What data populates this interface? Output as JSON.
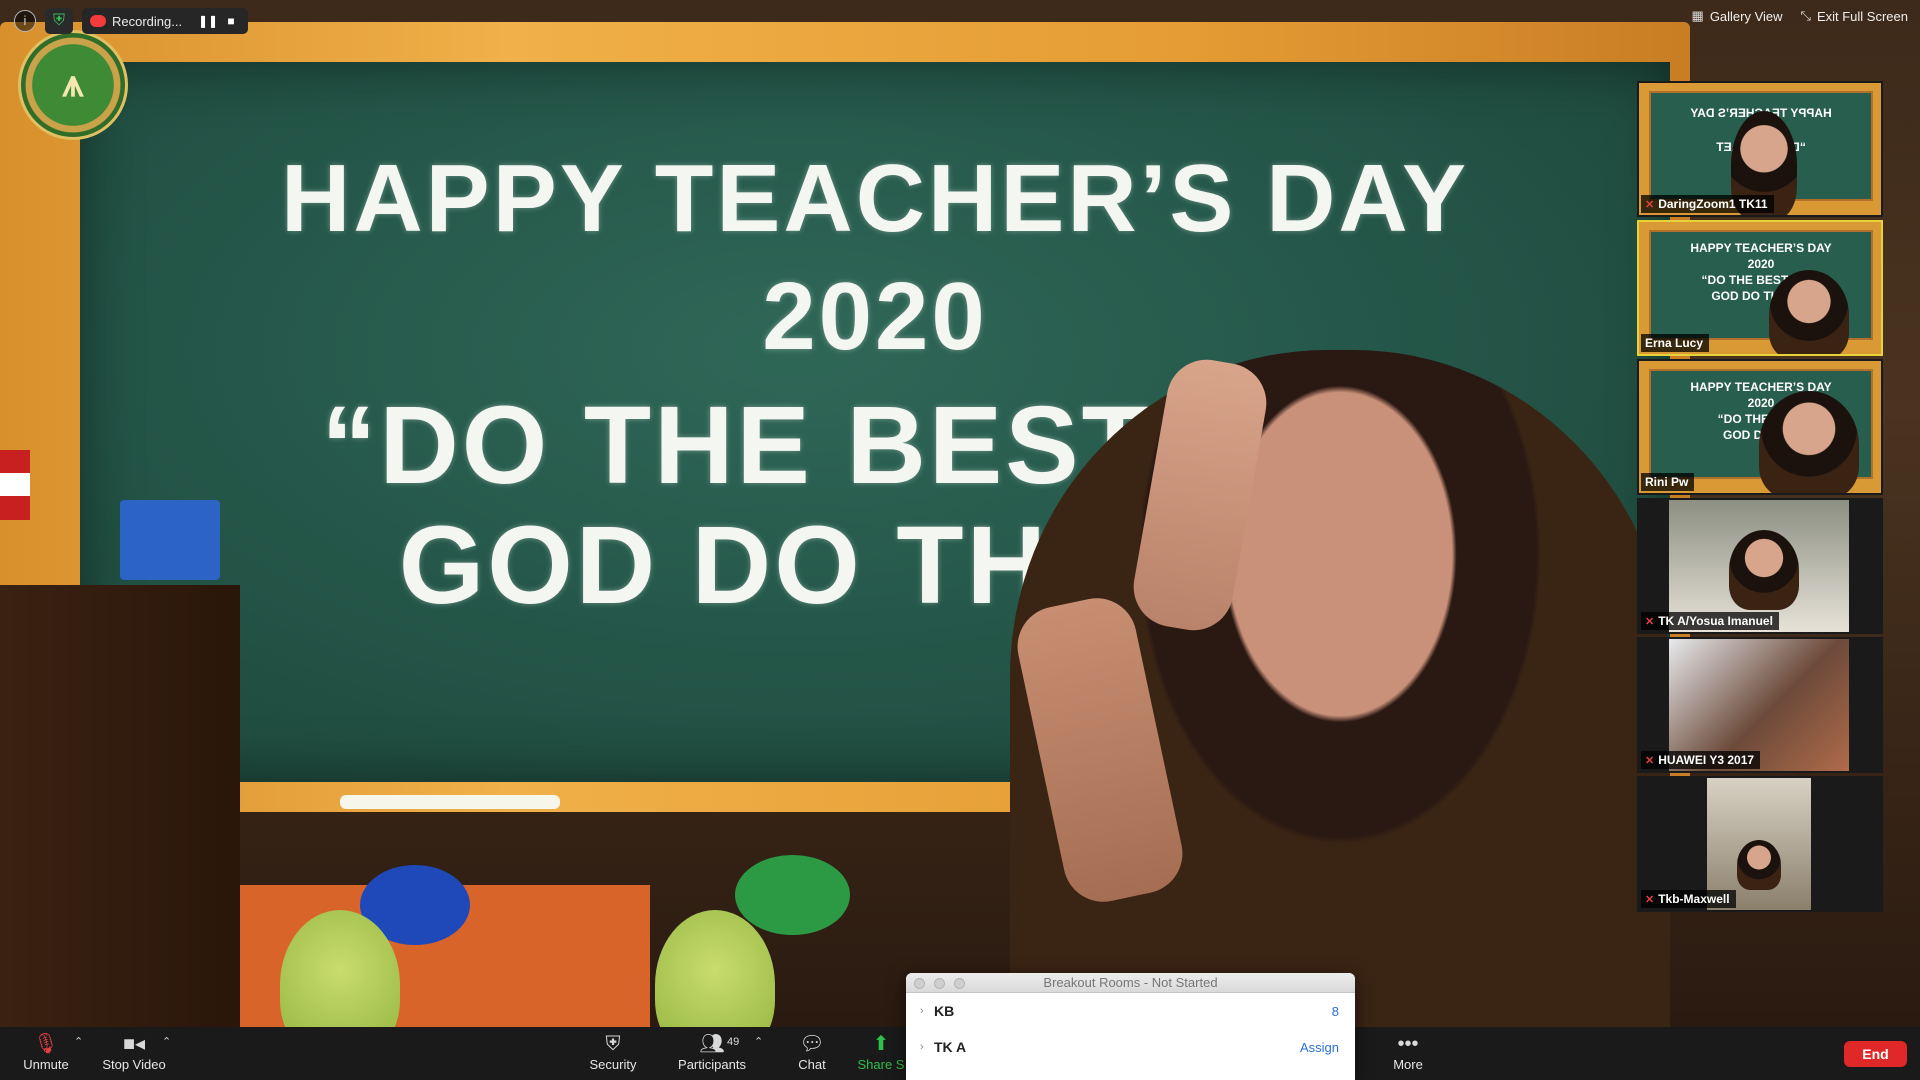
{
  "meeting": {
    "shared_board": {
      "line1": "HAPPY TEACHER’S DAY",
      "line2": "2020",
      "line3": "“DO THE BEST AND",
      "line4": "GOD DO THE R S"
    }
  },
  "top_bar": {
    "recording_label": "Recording...",
    "gallery_view_label": "Gallery View",
    "exit_full_screen_label": "Exit Full Screen"
  },
  "participants_gallery": [
    {
      "name": "DaringZoom1 TK11",
      "muted": true,
      "board_text": [
        "HAPPY TEACHER’S DAY",
        "“DO T  AND LET",
        "GO  REST”"
      ],
      "mirrored": true
    },
    {
      "name": "Erna Lucy",
      "muted": false,
      "active_speaker": true,
      "board_text": [
        "HAPPY TEACHER’S DAY",
        "2020",
        "“DO THE BEST AN D",
        "GOD DO THE R S"
      ]
    },
    {
      "name": "Rini Pw",
      "muted": false,
      "board_text": [
        "HAPPY TEACHER’S DAY",
        "2020",
        "“DO THE BEST",
        "GOD DO THE"
      ]
    },
    {
      "name": "TK A/Yosua Imanuel",
      "muted": true
    },
    {
      "name": "HUAWEI Y3 2017",
      "muted": true
    },
    {
      "name": "Tkb-Maxwell",
      "muted": true
    }
  ],
  "toolbar": {
    "unmute_label": "Unmute",
    "stop_video_label": "Stop Video",
    "security_label": "Security",
    "participants_label": "Participants",
    "participants_count": "49",
    "chat_label": "Chat",
    "share_label": "Share S",
    "more_label": "More",
    "end_label": "End"
  },
  "breakout_rooms": {
    "title": "Breakout Rooms - Not Started",
    "rooms": [
      {
        "name": "KB",
        "value": "8"
      },
      {
        "name": "TK A",
        "value": "Assign"
      }
    ]
  },
  "colors": {
    "end_button": "#e02828",
    "active_speaker_border": "#e8d23a",
    "link_blue": "#2d6fd8",
    "share_green": "#2fbf4d",
    "muted_red": "#e24040"
  }
}
